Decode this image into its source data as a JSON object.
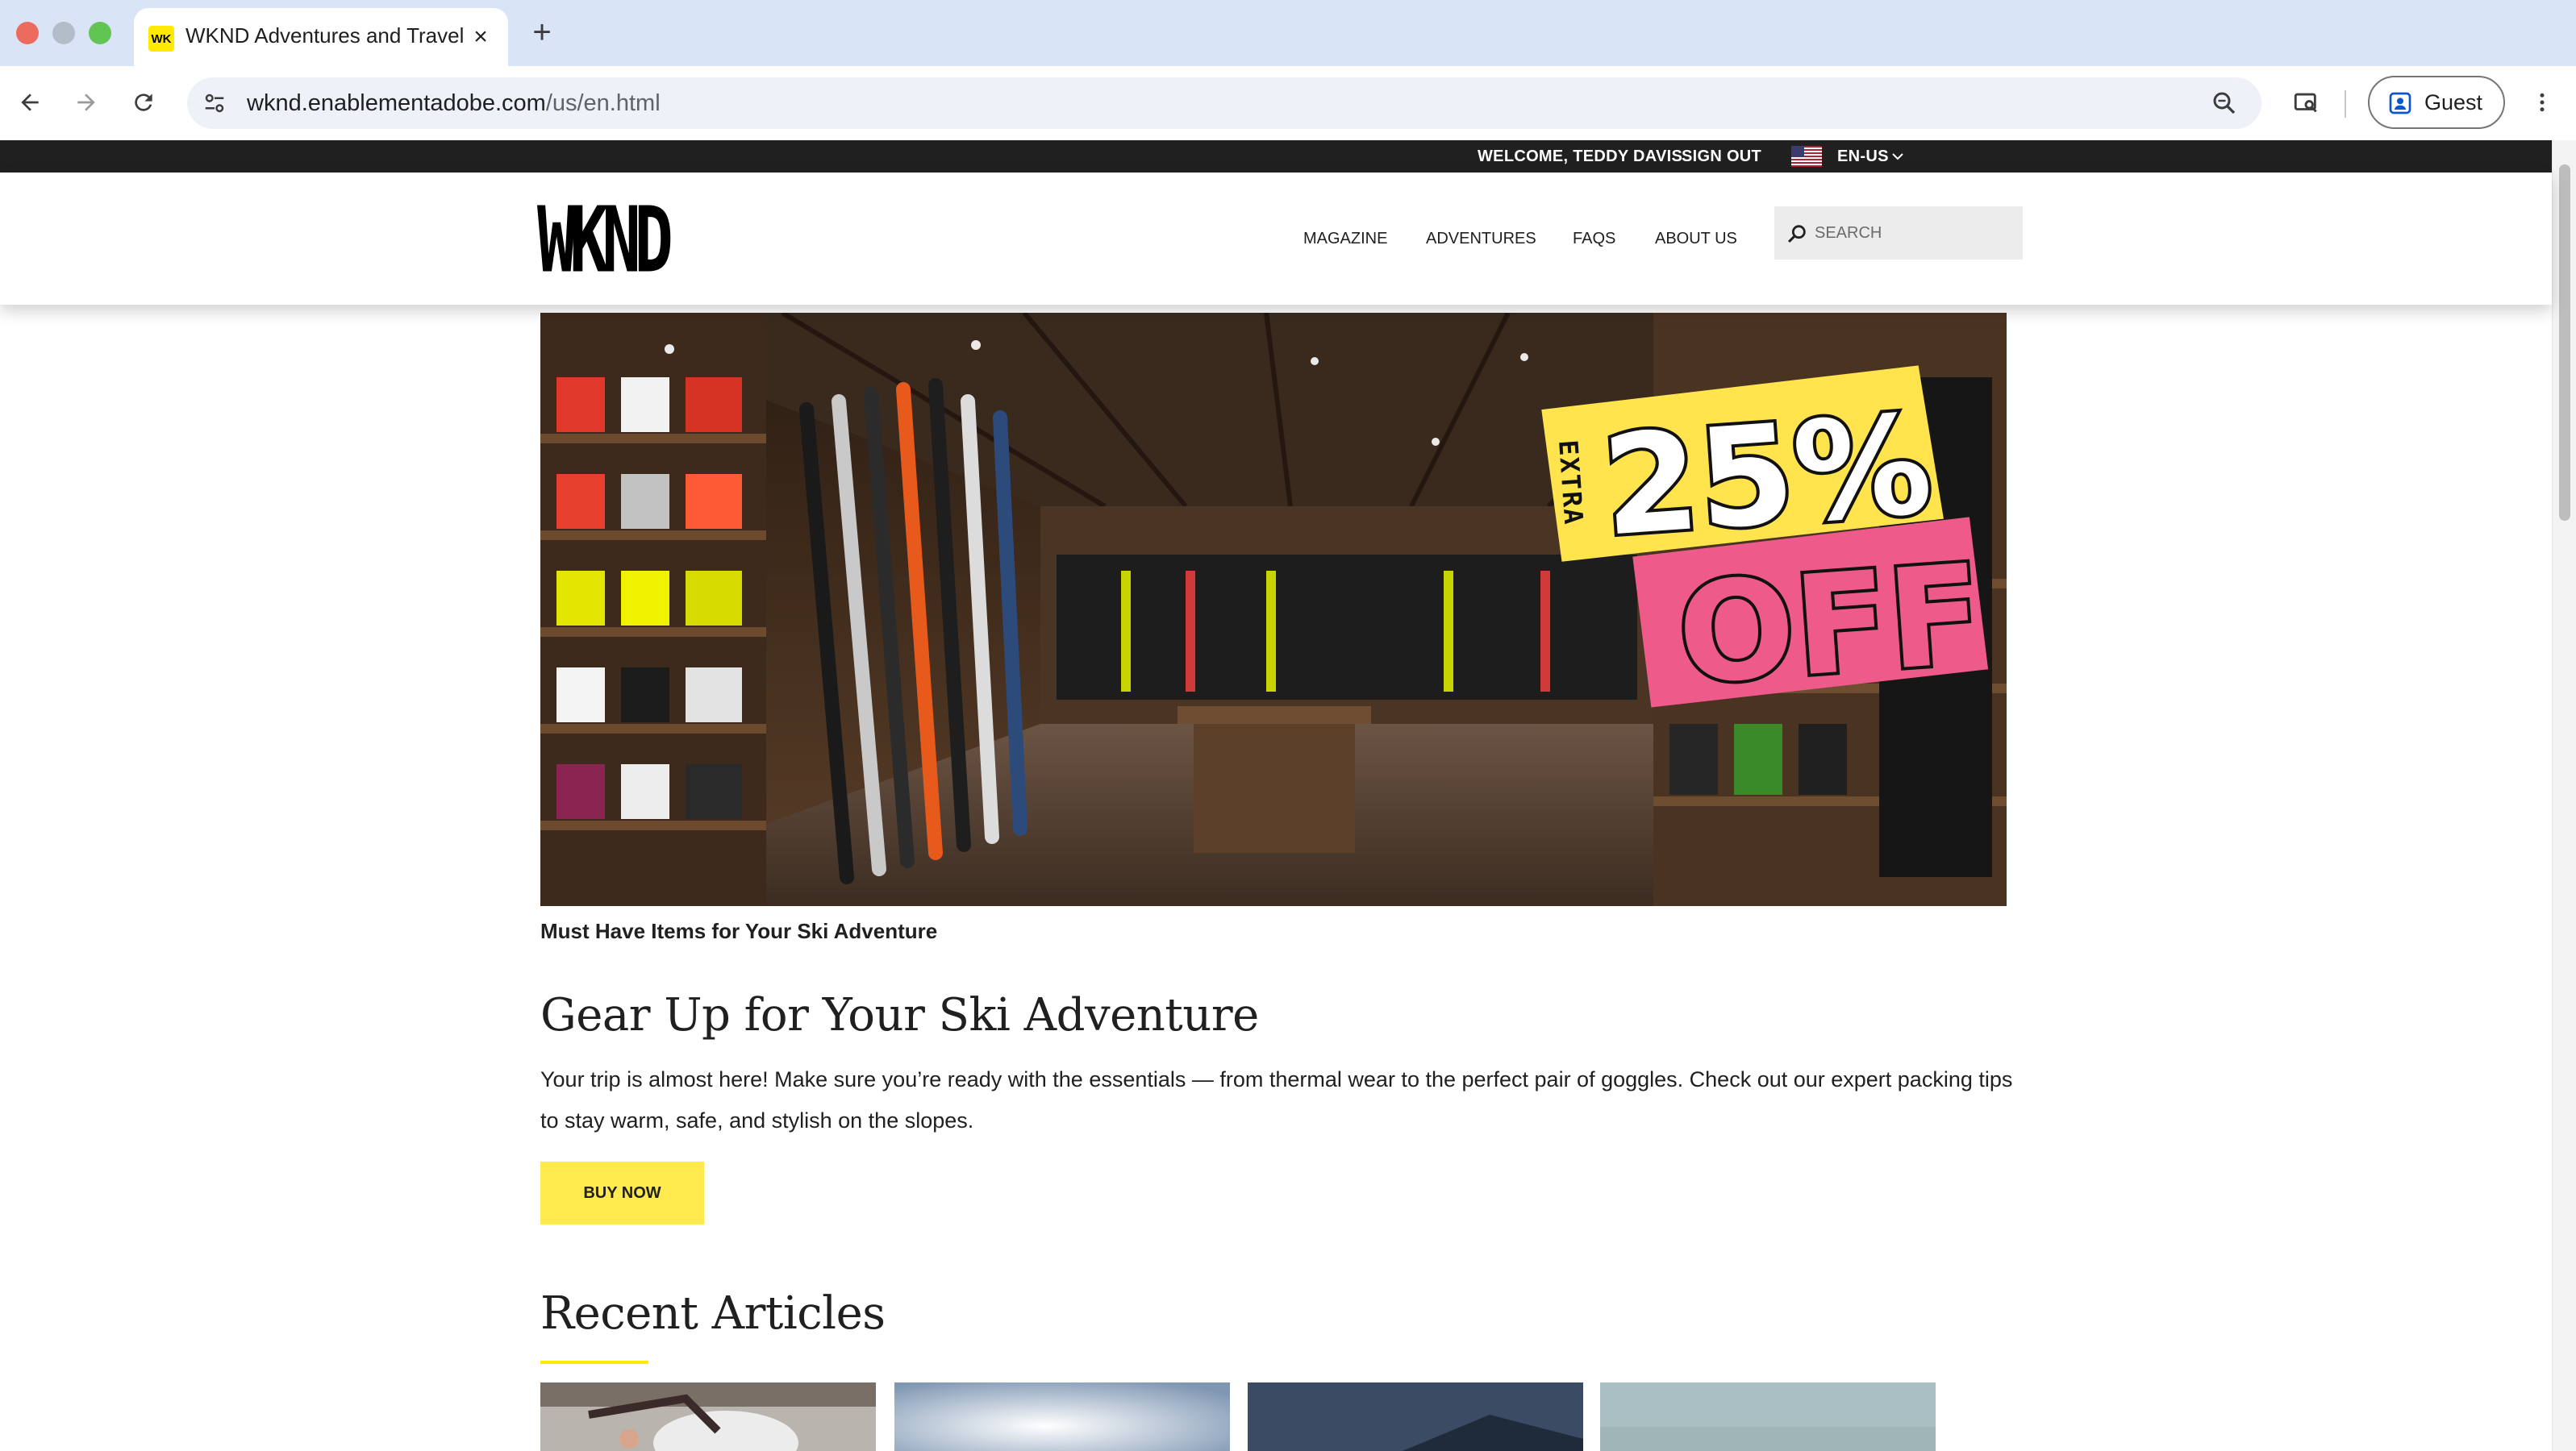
{
  "browser": {
    "tab_title": "WKND Adventures and Travel",
    "favicon_text": "WK",
    "url_host": "wknd.enablementadobe.com",
    "url_path": "/us/en.html",
    "profile_label": "Guest"
  },
  "topbar": {
    "welcome": "WELCOME, TEDDY DAVIS",
    "sign_out": "SIGN OUT",
    "language": "EN-US"
  },
  "header": {
    "logo": "WKND",
    "nav": [
      "MAGAZINE",
      "ADVENTURES",
      "FAQS",
      "ABOUT US"
    ],
    "search_placeholder": "SEARCH"
  },
  "hero": {
    "promo_vertical": "EXTRA",
    "promo_percent": "25%",
    "promo_off": "OFF",
    "caption": "Must Have Items for Your Ski Adventure"
  },
  "main": {
    "headline": "Gear Up for Your Ski Adventure",
    "body": "Your trip is almost here! Make sure you’re ready with the essentials — from thermal wear to the perfect pair of goggles. Check out our expert packing tips to stay warm, safe, and stylish on the slopes.",
    "cta": "BUY NOW",
    "recent_title": "Recent Articles"
  },
  "colors": {
    "accent_yellow": "#ffea00",
    "promo_pink": "#ee5b8a",
    "topbar_bg": "#202020"
  }
}
